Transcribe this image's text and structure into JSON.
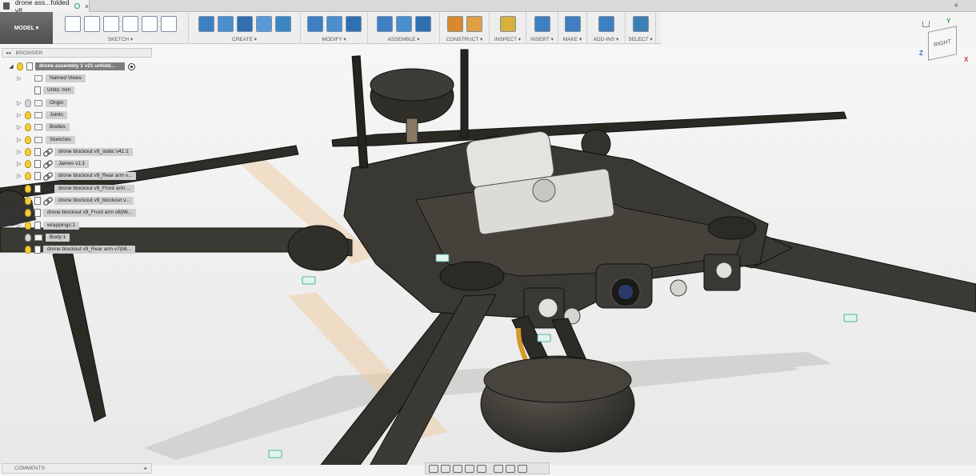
{
  "tab": {
    "title": "drone ass...folded v8",
    "close": "×"
  },
  "new_tab": "+",
  "workspace": {
    "label": "MODEL ▾"
  },
  "toolbar": [
    {
      "label": "SKETCH",
      "icons": [
        "sketch-icon",
        "arc-icon",
        "spline-icon",
        "slot-icon",
        "mirror-sketch-icon",
        "fillet-sketch-icon"
      ]
    },
    {
      "label": "CREATE",
      "icons": [
        "box-icon",
        "sculpt-icon",
        "revolve-icon",
        "mirror-icon",
        "extrude-icon"
      ]
    },
    {
      "label": "MODIFY",
      "icons": [
        "press-pull-icon",
        "fillet-icon",
        "combine-icon"
      ]
    },
    {
      "label": "ASSEMBLE",
      "icons": [
        "component-icon",
        "joint-icon",
        "as-built-joint-icon"
      ]
    },
    {
      "label": "CONSTRUCT",
      "icons": [
        "plane-icon",
        "offset-plane-icon"
      ]
    },
    {
      "label": "INSPECT",
      "icons": [
        "measure-icon"
      ]
    },
    {
      "label": "INSERT",
      "icons": [
        "insert-image-icon"
      ]
    },
    {
      "label": "MAKE",
      "icons": [
        "print-3d-icon"
      ]
    },
    {
      "label": "ADD-INS",
      "icons": [
        "scripts-icon"
      ]
    },
    {
      "label": "SELECT",
      "icons": [
        "select-cursor-icon"
      ]
    }
  ],
  "browser": {
    "header": "BROWSER",
    "root": "drone assembly 1 v21 unfold...",
    "items": [
      {
        "label": "Named Views",
        "kind": "folder",
        "visible": null,
        "expander": true,
        "indent": 1
      },
      {
        "label": "Units: mm",
        "kind": "doc",
        "visible": null,
        "expander": false,
        "indent": 1
      },
      {
        "label": "Origin",
        "kind": "folder",
        "visible": false,
        "expander": true,
        "indent": 1
      },
      {
        "label": "Joints",
        "kind": "folder",
        "visible": true,
        "expander": true,
        "indent": 1
      },
      {
        "label": "Bodies",
        "kind": "folder",
        "visible": true,
        "expander": true,
        "indent": 1
      },
      {
        "label": "Sketches",
        "kind": "folder",
        "visible": true,
        "expander": true,
        "indent": 1
      },
      {
        "label": "drone blockout v9_static v41:1",
        "kind": "link",
        "visible": true,
        "expander": true,
        "indent": 1
      },
      {
        "label": "James v1:1",
        "kind": "link",
        "visible": true,
        "expander": true,
        "indent": 1
      },
      {
        "label": "drone blockout v9_Rear arm v...",
        "kind": "link",
        "visible": true,
        "expander": true,
        "indent": 1
      },
      {
        "label": "drone blockout v9_Front arm ...",
        "kind": "link",
        "visible": true,
        "expander": true,
        "indent": 1
      },
      {
        "label": "drone blockout v9_blockout v...",
        "kind": "link",
        "visible": true,
        "expander": true,
        "indent": 1
      },
      {
        "label": "drone blockout v9_Front arm v8(Mi...",
        "kind": "doc",
        "visible": true,
        "expander": true,
        "indent": 1
      },
      {
        "label": "wrappings:1",
        "kind": "doc",
        "visible": true,
        "expander": true,
        "indent": 1
      },
      {
        "label": "Body:1",
        "kind": "folder",
        "visible": false,
        "expander": true,
        "indent": 1
      },
      {
        "label": "drone blockout v9_Rear arm v7(Mi...",
        "kind": "doc",
        "visible": true,
        "expander": true,
        "indent": 1
      }
    ]
  },
  "comments": {
    "label": "COMMENTS",
    "add": "+"
  },
  "viewcube": {
    "face": "RIGHT",
    "x_axis": "X",
    "y_axis": "Y",
    "z_axis": "Z"
  },
  "colors": {
    "toolbar_bg": "#eeeeee",
    "workspace_bg": "#5d5d5d",
    "accent_teal": "#2d9f87",
    "drone_body": "#3b3933",
    "drone_edge": "#16160f",
    "bulb_on": "#f2cc3a",
    "select_active": "#3c7fb3"
  }
}
